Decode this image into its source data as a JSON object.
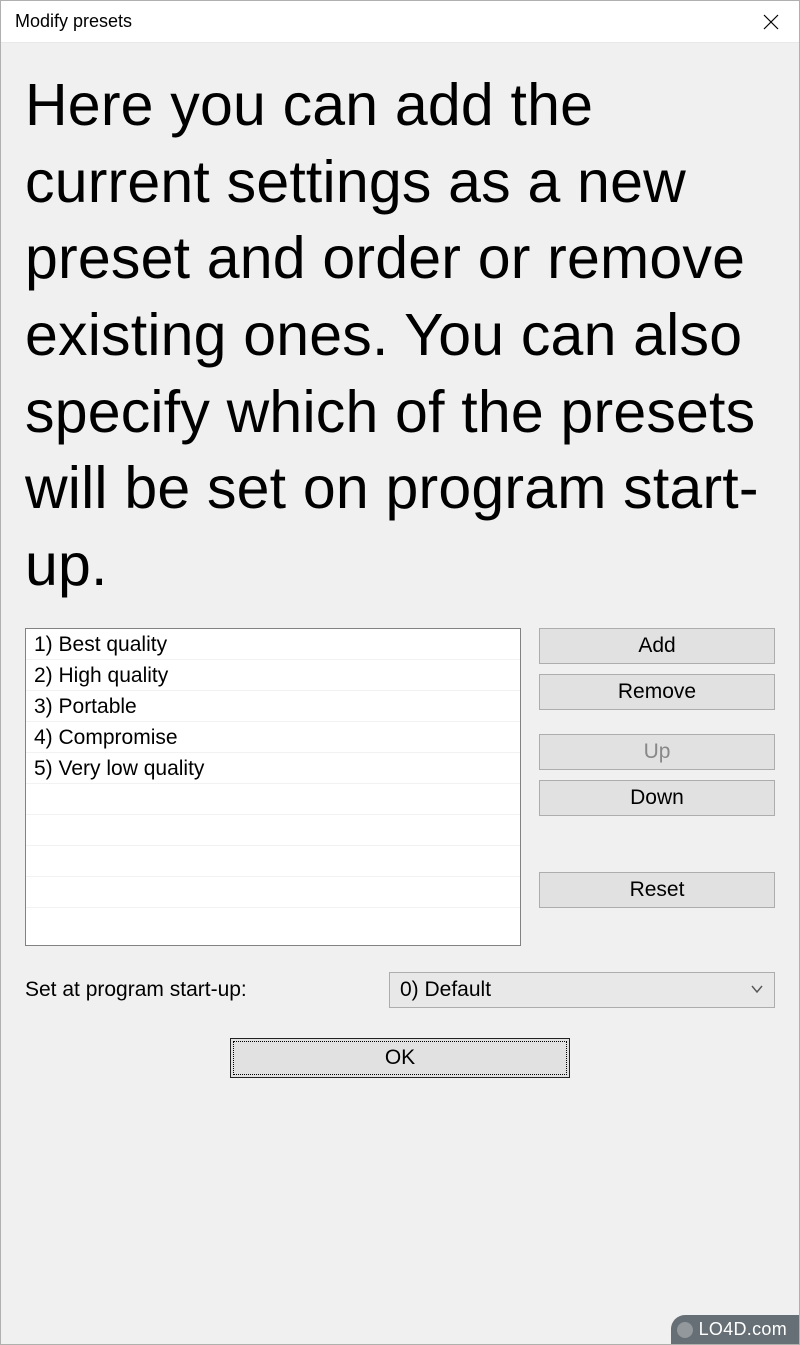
{
  "title": "Modify presets",
  "description": "Here you can add the current settings as a new preset and order or remove existing ones. You can also specify which of the presets will be set on program start-up.",
  "presets": [
    "1)  Best quality",
    "2)  High quality",
    "3)  Portable",
    "4)  Compromise",
    "5)  Very low quality"
  ],
  "buttons": {
    "add": "Add",
    "remove": "Remove",
    "up": "Up",
    "down": "Down",
    "reset": "Reset"
  },
  "startup": {
    "label": "Set at program start-up:",
    "selected": "0)  Default"
  },
  "ok": "OK",
  "watermark": "LO4D.com"
}
